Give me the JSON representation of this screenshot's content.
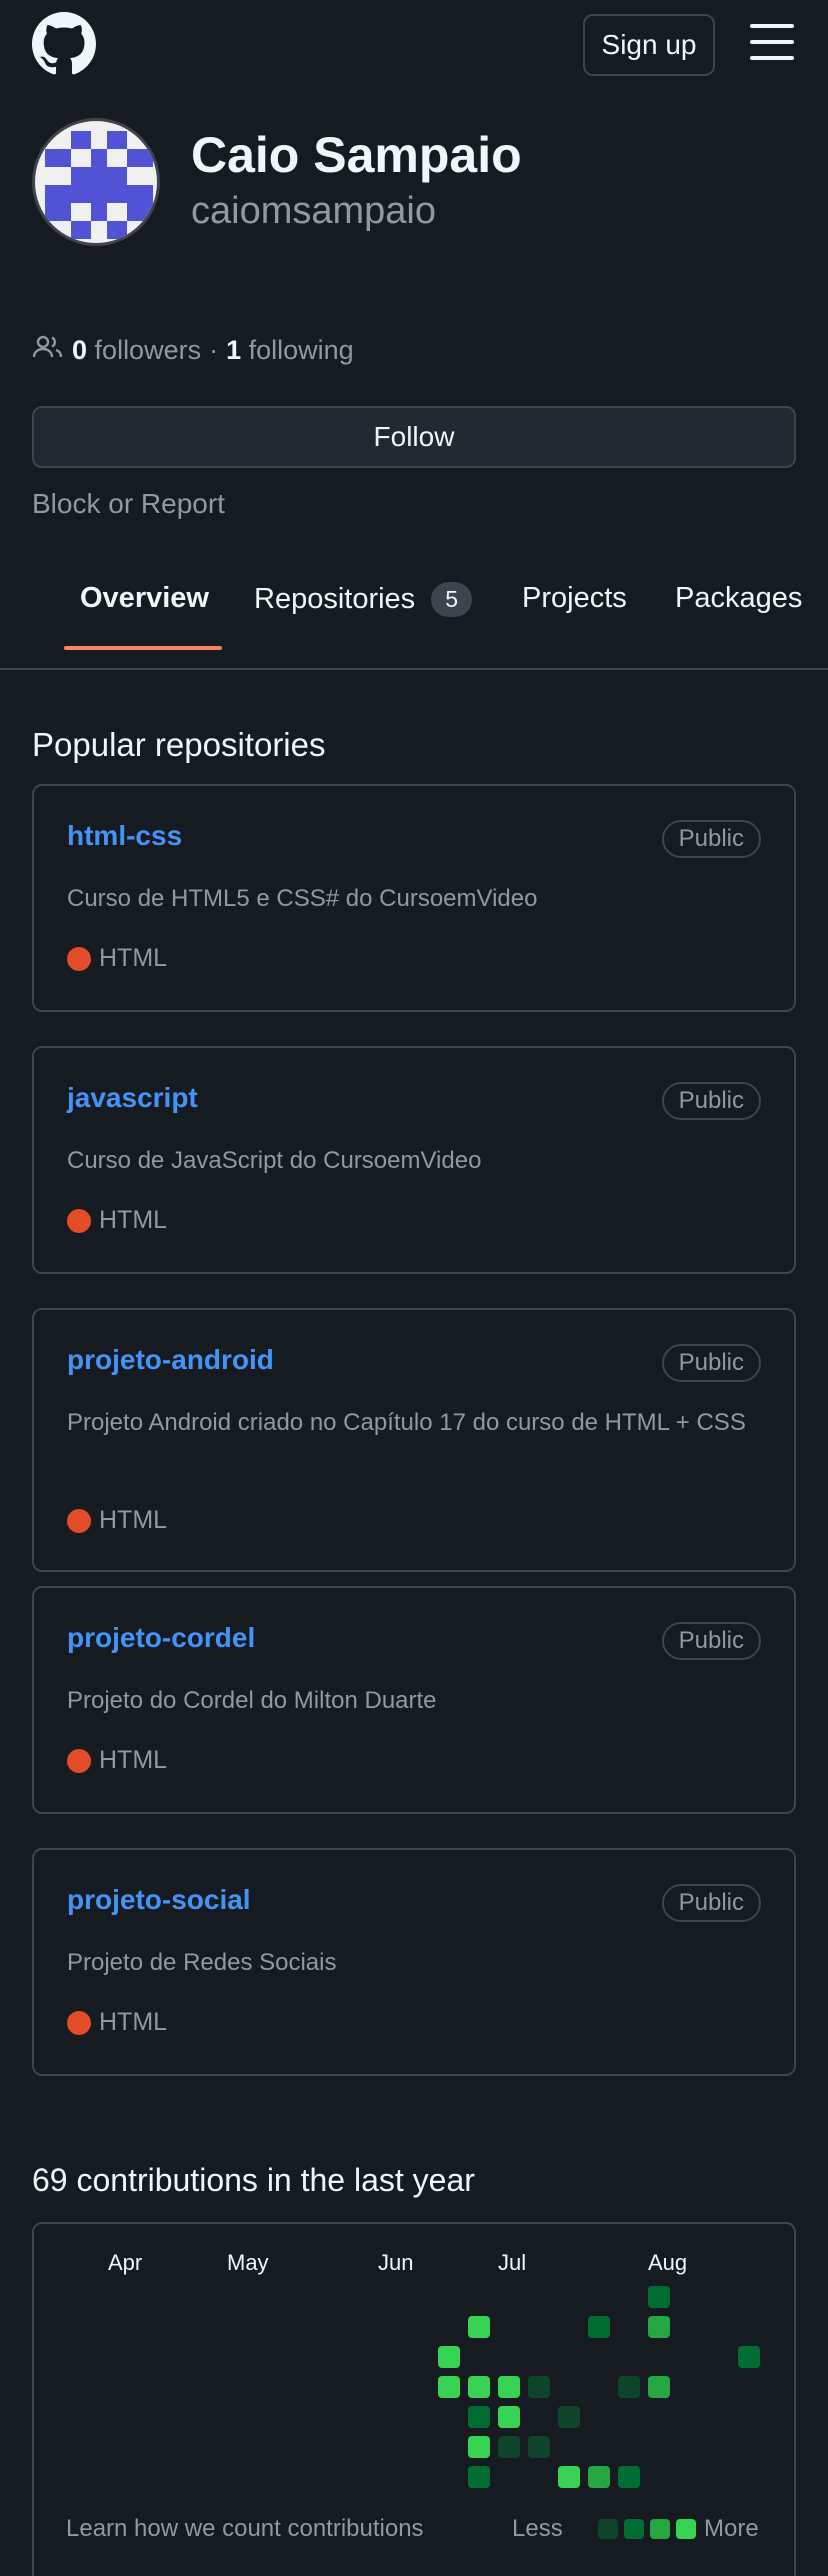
{
  "header": {
    "logo_icon": "github-mark-icon",
    "signup_label": "Sign up",
    "menu_icon": "hamburger-menu-icon"
  },
  "profile": {
    "name": "Caio Sampaio",
    "login": "caiomsampaio",
    "followers_count": "0",
    "followers_label": "followers",
    "separator": "·",
    "following_count": "1",
    "following_label": "following",
    "follow_label": "Follow",
    "block_label": "Block or Report"
  },
  "tabs": [
    {
      "label": "Overview",
      "active": true
    },
    {
      "label": "Repositories",
      "count": "5"
    },
    {
      "label": "Projects"
    },
    {
      "label": "Packages"
    }
  ],
  "popular": {
    "title": "Popular repositories",
    "repos": [
      {
        "name": "html-css",
        "badge": "Public",
        "description": "Curso de HTML5 e CSS# do CursoemVideo",
        "language": "HTML"
      },
      {
        "name": "javascript",
        "badge": "Public",
        "description": "Curso de JavaScript do CursoemVideo",
        "language": "HTML"
      },
      {
        "name": "projeto-android",
        "badge": "Public",
        "description": "Projeto Android criado no Capítulo 17 do curso de HTML + CSS",
        "language": "HTML"
      },
      {
        "name": "projeto-cordel",
        "badge": "Public",
        "description": "Projeto do Cordel do Milton Duarte",
        "language": "HTML"
      },
      {
        "name": "projeto-social",
        "badge": "Public",
        "description": "Projeto de Redes Sociais",
        "language": "HTML"
      }
    ]
  },
  "contributions": {
    "title": "69 contributions in the last year",
    "months": [
      "Apr",
      "May",
      "Jun",
      "Jul",
      "Aug"
    ],
    "learn_label": "Learn how we count contributions",
    "less_label": "Less",
    "more_label": "More",
    "colors": {
      "l1": "#0e4429",
      "l2": "#006d32",
      "l3": "#26a641",
      "l4": "#39d353"
    }
  }
}
